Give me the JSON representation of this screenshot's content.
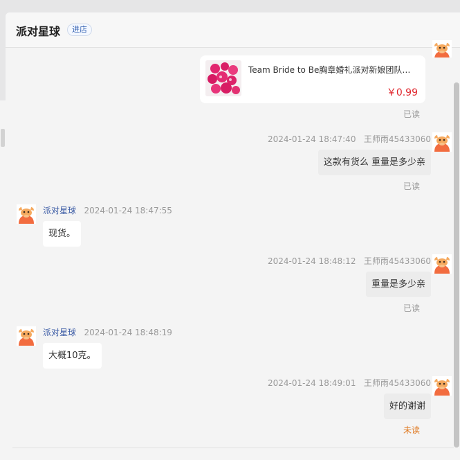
{
  "header": {
    "shop_name": "派对星球",
    "enter_store_label": "进店"
  },
  "product_card": {
    "title": "Team Bride to Be胸章婚礼派对新娘团队新娘...",
    "price": "￥0.99",
    "status": "已读"
  },
  "messages": [
    {
      "direction": "out",
      "time": "2024-01-24 18:47:40",
      "sender": "王师雨45433060",
      "text": "这款有货么  重量是多少亲",
      "status": "已读"
    },
    {
      "direction": "in",
      "sender": "派对星球",
      "time": "2024-01-24 18:47:55",
      "text": "现货。"
    },
    {
      "direction": "out",
      "time": "2024-01-24 18:48:12",
      "sender": "王师雨45433060",
      "text": "重量是多少亲",
      "status": "已读"
    },
    {
      "direction": "in",
      "sender": "派对星球",
      "time": "2024-01-24 18:48:19",
      "text": "大概10克。"
    },
    {
      "direction": "out",
      "time": "2024-01-24 18:49:01",
      "sender": "王师雨45433060",
      "text": "好的谢谢",
      "status": "未读"
    }
  ],
  "colors": {
    "unread_status": "#e07a22",
    "price": "#e0252c",
    "sender_link": "#3b5ba5",
    "avatar_body": "#f26c3f"
  },
  "icons": {
    "avatar": "cartoon-bull-avatar-icon",
    "product_image": "pink-badges-thumbnail"
  }
}
